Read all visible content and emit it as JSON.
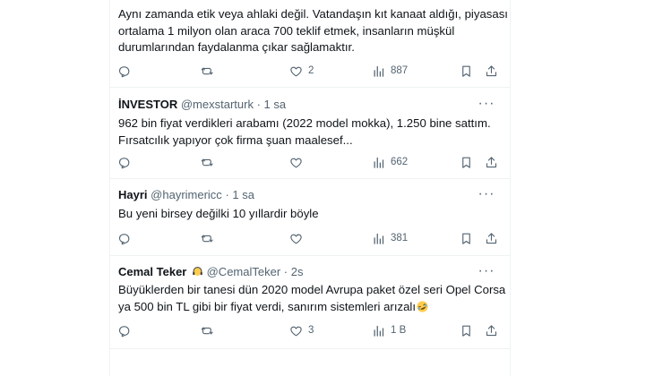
{
  "tweets": [
    {
      "name": "",
      "handle": "",
      "time": "",
      "lines": [
        "Aynı zamanda etik veya ahlaki değil. Vatandaşın kıt kanaat aldığı, piyasası",
        "ortalama 1 milyon olan araca 700 teklif etmek,  insanların müşkül",
        "durumlarından faydalanma çıkar sağlamaktır."
      ],
      "replies": "",
      "retweets": "",
      "likes": "2",
      "views": "887"
    },
    {
      "name": "İNVESTOR",
      "handle": "@mexstarturk",
      "time": "1 sa",
      "lines": [
        "962 bin fiyat verdikleri arabamı (2022 model mokka), 1.250 bine sattım.",
        "Fırsatcılık yapıyor çok firma şuan maalesef..."
      ],
      "replies": "",
      "retweets": "",
      "likes": "",
      "views": "662"
    },
    {
      "name": "Hayri",
      "handle": "@hayrimericc",
      "time": "1 sa",
      "lines": [
        "Bu yeni birsey değilki 10 yıllardir böyle"
      ],
      "replies": "",
      "retweets": "",
      "likes": "",
      "views": "381"
    },
    {
      "name": "Cemal Teker",
      "handle": "@CemalTeker",
      "time": "2s",
      "lines": [
        "Büyüklerden bir tanesi dün 2020 model Avrupa paket özel seri Opel Corsa",
        "ya 500 bin TL gibi bir fiyat verdi, sanırım sistemleri arızalı"
      ],
      "replies": "",
      "retweets": "",
      "likes": "3",
      "views": "1 B"
    }
  ],
  "dot": "·",
  "more_glyph": "···",
  "icons": {
    "reply": "reply-icon",
    "retweet": "retweet-icon",
    "like": "heart-icon",
    "views": "views-icon",
    "bookmark": "bookmark-icon",
    "share": "share-icon"
  },
  "colors": {
    "text": "#0f1419",
    "secondary": "#536471",
    "border": "#eff3f4"
  }
}
